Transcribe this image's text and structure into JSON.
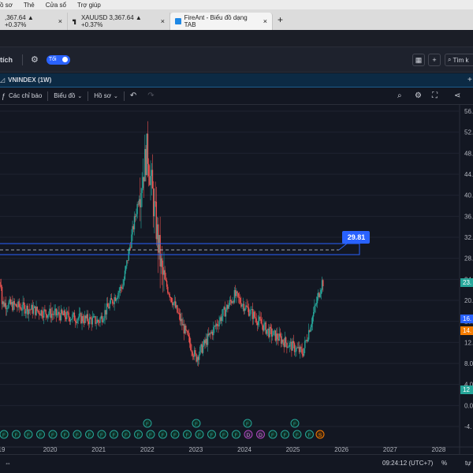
{
  "menubar": {
    "items": [
      "ồ sơ",
      "Thẻ",
      "Cửa sổ",
      "Trợ giúp"
    ]
  },
  "tabs": [
    {
      "label": ",367.64 ▲ +0.37%",
      "active": false
    },
    {
      "label": "XAUUSD 3,367.64 ▲ +0.37%",
      "active": false
    },
    {
      "label": "FireAnt - Biểu đồ dạng TAB",
      "active": true
    }
  ],
  "toolbar1": {
    "left_label": "tích",
    "toggle_label": "Tối",
    "search_placeholder": "Tìm k",
    "plus_label": "+"
  },
  "chart_title": {
    "label": "VNINDEX (1W)",
    "plus": "+"
  },
  "toolbar2": {
    "indicators": "Các chỉ báo",
    "chart": "Biểu đồ",
    "profile": "Hồ sơ"
  },
  "price_axis": {
    "ticks": [
      "56.",
      "52.",
      "48.",
      "44.",
      "40.",
      "36.",
      "32.",
      "28.",
      "24.",
      "20.",
      "16.",
      "12.",
      "8.0",
      "4.0",
      "0.0",
      "-4."
    ]
  },
  "hline": {
    "value": "29.81"
  },
  "badges": [
    {
      "label": "23.",
      "color": "#26a69a"
    },
    {
      "label": "16.",
      "color": "#2962ff"
    },
    {
      "label": "14.",
      "color": "#f57c00"
    },
    {
      "label": "12",
      "color": "#26a69a"
    }
  ],
  "time_axis": {
    "labels": [
      "19",
      "2020",
      "2021",
      "2022",
      "2023",
      "2024",
      "2025",
      "2026",
      "2027",
      "2028"
    ]
  },
  "markers": {
    "f": "F",
    "d": "D",
    "s": "S"
  },
  "bottombar": {
    "clock": "09:24:12 (UTC+7)",
    "percent": "%",
    "more": "tự"
  },
  "colors": {
    "up": "#26a69a",
    "down": "#ef5350",
    "accent": "#2962ff",
    "background": "#131722"
  },
  "chart_data": {
    "type": "candlestick",
    "x_axis": {
      "labels": [
        "2020",
        "2021",
        "2022",
        "2023",
        "2024",
        "2025",
        "2026",
        "2027",
        "2028"
      ]
    },
    "y_axis": {
      "range": [
        -4,
        58
      ]
    },
    "horizontal_line": 29.81,
    "series": [
      {
        "x": "2019",
        "y": 19.5
      },
      {
        "x": "2020",
        "y": 17.5
      },
      {
        "x": "2021",
        "y": 16.0
      },
      {
        "x": "2021.5",
        "y": 23.0
      },
      {
        "x": "2022",
        "y": 48.7
      },
      {
        "x": "2022.3",
        "y": 25.0
      },
      {
        "x": "2023",
        "y": 9.0
      },
      {
        "x": "2023.8",
        "y": 21.0
      },
      {
        "x": "2024.5",
        "y": 14.0
      },
      {
        "x": "2025.2",
        "y": 10.0
      },
      {
        "x": "2025.6",
        "y": 23.5
      }
    ]
  }
}
